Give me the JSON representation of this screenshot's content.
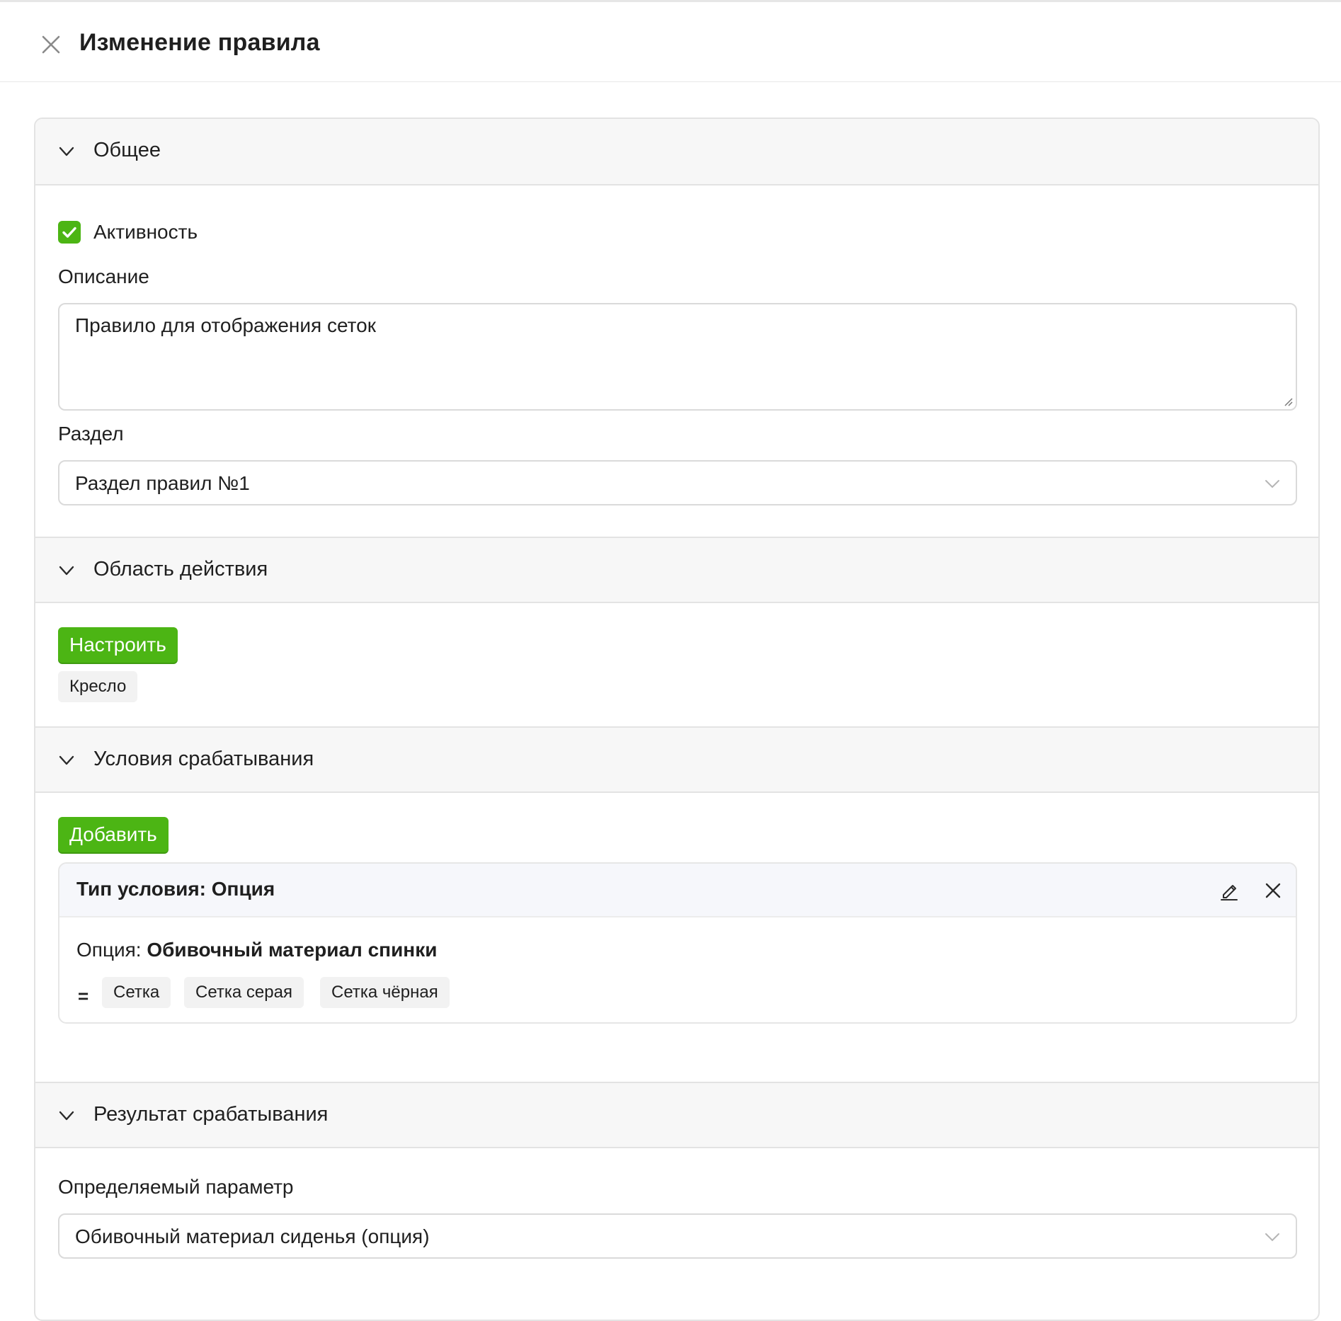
{
  "header": {
    "title": "Изменение правила"
  },
  "sections": {
    "general": {
      "title": "Общее",
      "active_label": "Активность",
      "active_checked": true,
      "description_label": "Описание",
      "description_value": "Правило для отображения сеток",
      "section_label": "Раздел",
      "section_value": "Раздел правил №1"
    },
    "scope": {
      "title": "Область действия",
      "configure_button": "Настроить",
      "tags": [
        "Кресло"
      ]
    },
    "conditions": {
      "title": "Условия срабатывания",
      "add_button": "Добавить",
      "condition": {
        "type_title": "Тип условия: Опция",
        "option_label": "Опция:",
        "option_value": "Обивочный материал спинки",
        "operator": "=",
        "values": [
          "Сетка",
          "Сетка серая",
          "Сетка чёрная"
        ]
      }
    },
    "result": {
      "title": "Результат срабатывания",
      "param_label": "Определяемый параметр",
      "param_value": "Обивочный материал сиденья (опция)"
    }
  },
  "colors": {
    "accent": "#4cb514",
    "border": "#e3e3e3",
    "section_bg": "#f7f7f7"
  }
}
